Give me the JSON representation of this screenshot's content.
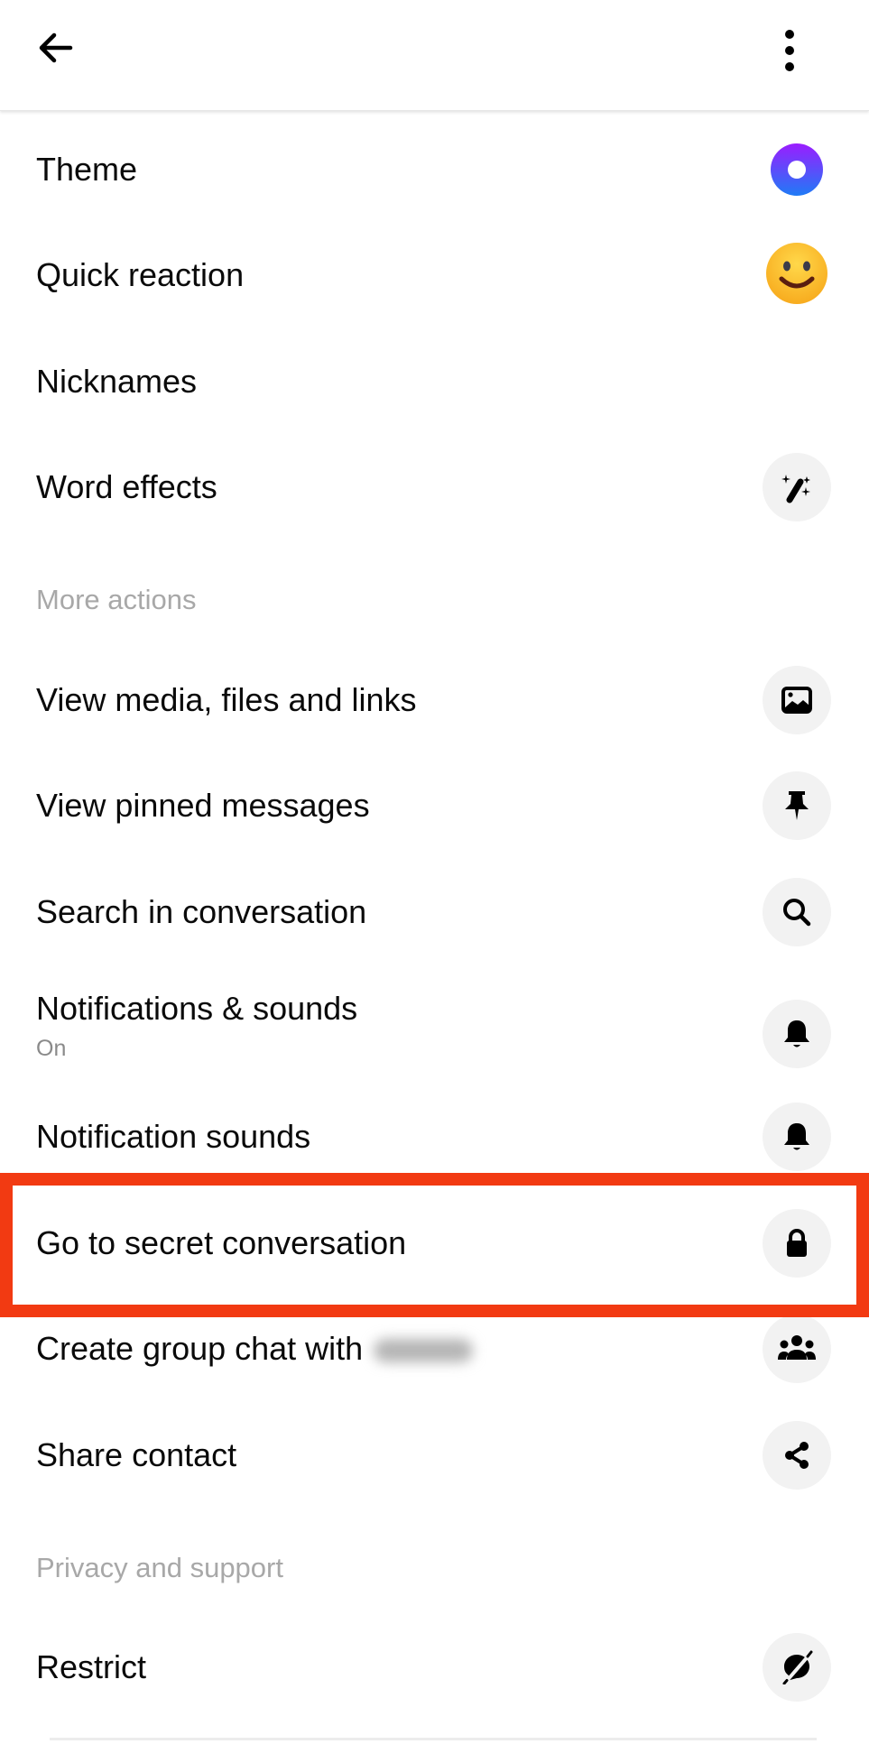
{
  "header": {
    "back_icon": "arrow-left-icon",
    "menu_icon": "more-vertical-icon"
  },
  "customization": {
    "items": [
      {
        "label": "Theme",
        "icon": "theme-ring-icon",
        "accent_from": "#9b1dff",
        "accent_to": "#1f7bf6"
      },
      {
        "label": "Quick reaction",
        "icon": "smiley-emoji-icon"
      },
      {
        "label": "Nicknames"
      },
      {
        "label": "Word effects",
        "icon": "magic-wand-icon"
      }
    ]
  },
  "more_actions": {
    "header": "More actions",
    "items": [
      {
        "label": "View media, files and links",
        "icon": "image-icon"
      },
      {
        "label": "View pinned messages",
        "icon": "pin-icon"
      },
      {
        "label": "Search in conversation",
        "icon": "search-icon"
      },
      {
        "label": "Notifications  & sounds",
        "sublabel": "On",
        "icon": "bell-icon"
      },
      {
        "label": "Notification sounds",
        "icon": "bell-icon"
      },
      {
        "label": "Go to secret conversation",
        "icon": "lock-icon",
        "highlighted": true
      },
      {
        "label": "Create group chat with",
        "redacted_name": true,
        "icon": "group-icon"
      },
      {
        "label": "Share contact",
        "icon": "share-icon"
      }
    ]
  },
  "privacy_support": {
    "header": "Privacy and support",
    "items": [
      {
        "label": "Restrict",
        "icon": "restrict-icon"
      }
    ]
  },
  "annotation": {
    "highlight_color": "#f23a12",
    "highlighted_item": "Go to secret conversation"
  }
}
